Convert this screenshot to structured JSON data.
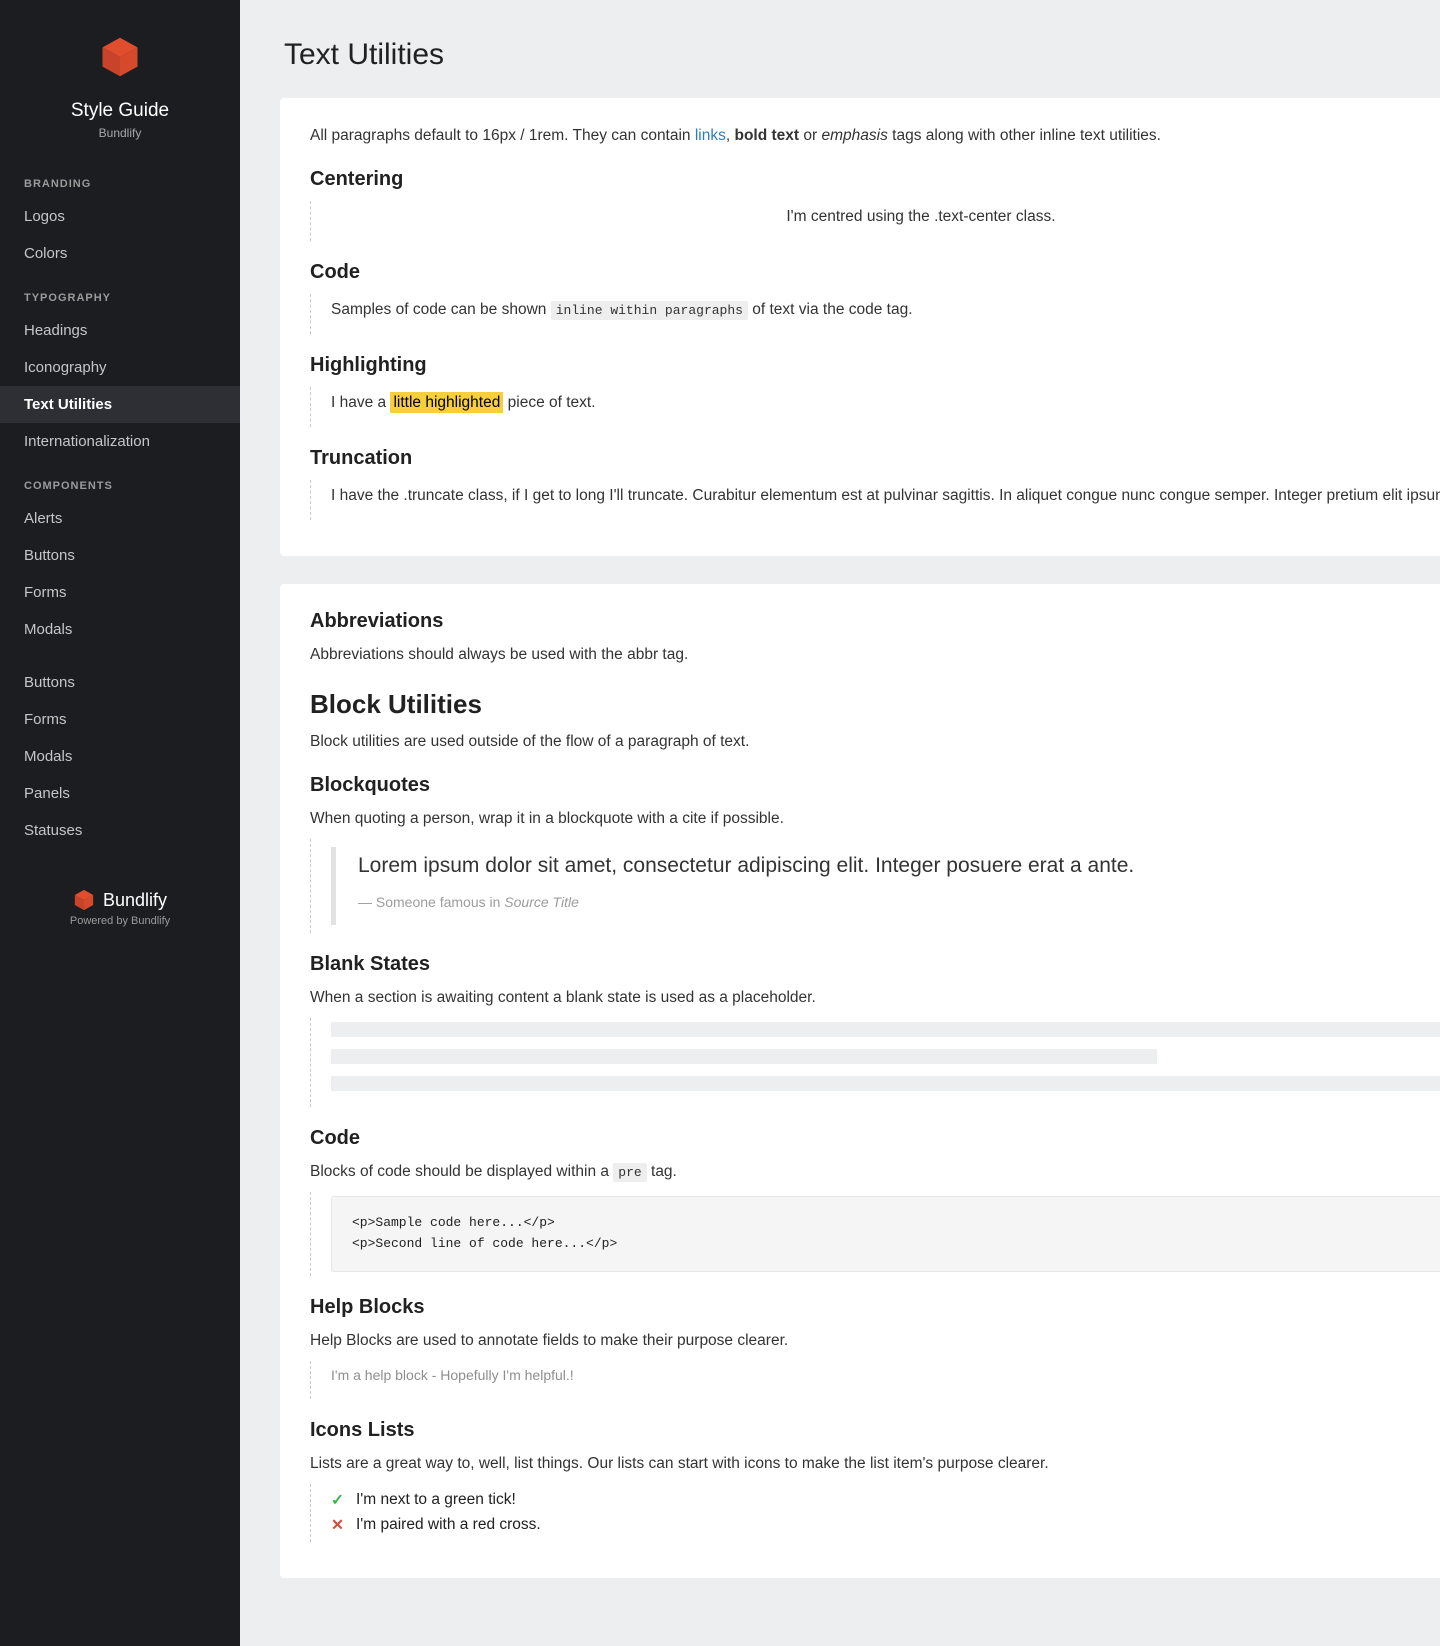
{
  "sidebar": {
    "title": "Style Guide",
    "subtitle": "Bundlify",
    "sections": [
      {
        "label": "BRANDING",
        "items": [
          "Logos",
          "Colors"
        ]
      },
      {
        "label": "TYPOGRAPHY",
        "items": [
          "Headings",
          "Iconography",
          "Text Utilities",
          "Internationalization"
        ]
      },
      {
        "label": "COMPONENTS",
        "items": [
          "Alerts",
          "Buttons",
          "Forms",
          "Modals"
        ]
      }
    ],
    "extra_items": [
      "Buttons",
      "Forms",
      "Modals",
      "Panels",
      "Statuses"
    ],
    "active": "Text Utilities",
    "footer_brand": "Bundlify",
    "footer_sub": "Powered by Bundlify"
  },
  "page": {
    "title": "Text Utilities"
  },
  "card1": {
    "intro_prefix": "All paragraphs default to 16px / 1rem. They can contain ",
    "intro_link": "links",
    "intro_mid1": ", ",
    "intro_bold": "bold text",
    "intro_mid2": " or ",
    "intro_em": "emphasis",
    "intro_suffix": " tags along with other inline text utilities.",
    "centering_head": "Centering",
    "centering_text": "I'm centred using the .text-center class.",
    "code_head": "Code",
    "code_prefix": "Samples of code can be shown ",
    "code_inline": "inline within paragraphs",
    "code_suffix": " of text via the code tag.",
    "highlight_head": "Highlighting",
    "highlight_prefix": "I have a ",
    "highlight_mark": "little highlighted",
    "highlight_suffix": " piece of text.",
    "trunc_head": "Truncation",
    "trunc_text": "I have the .truncate class, if I get to long I'll truncate. Curabitur elementum est at pulvinar sagittis. In aliquet congue nunc congue semper. Integer pretium elit ipsum dapibus."
  },
  "card2": {
    "abbr_head": "Abbreviations",
    "abbr_text": "Abbreviations should always be used with the abbr tag.",
    "blocku_head": "Block Utilities",
    "blocku_text": "Block utilities are used outside of the flow of a paragraph of text.",
    "bq_head": "Blockquotes",
    "bq_intro": "When quoting a person, wrap it in a blockquote with a cite if possible.",
    "bq_text": "Lorem ipsum dolor sit amet, consectetur adipiscing elit. Integer posuere erat a ante.",
    "bq_cite_prefix": "— Someone famous in ",
    "bq_cite_source": "Source Title",
    "blank_head": "Blank States",
    "blank_intro": "When a section is awaiting content a blank state is used as a placeholder.",
    "code_head": "Code",
    "code_intro_prefix": "Blocks of code should be displayed within a ",
    "code_intro_tag": "pre",
    "code_intro_suffix": " tag.",
    "code_block": "<p>Sample code here...</p>\n<p>Second line of code here...</p>",
    "help_head": "Help Blocks",
    "help_intro": "Help Blocks are used to annotate fields to make their purpose clearer.",
    "help_text": "I'm a help block - Hopefully I'm helpful.!",
    "iconlist_head": "Icons Lists",
    "iconlist_intro": "Lists are a great way to, well, list things. Our lists can start with icons to make the list item's purpose clearer.",
    "iconlist_items": [
      {
        "icon": "tick",
        "text": "I'm next to a green tick!"
      },
      {
        "icon": "cross",
        "text": "I'm paired with a red cross."
      }
    ]
  }
}
